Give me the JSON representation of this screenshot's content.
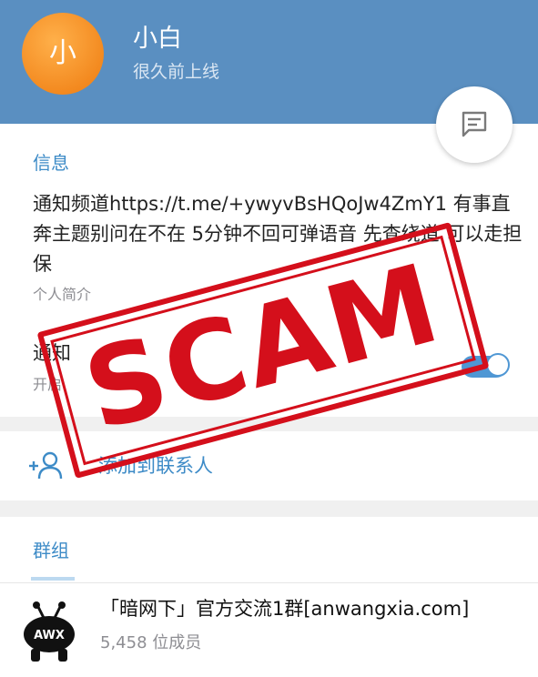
{
  "header": {
    "avatar_initial": "小",
    "name": "小白",
    "last_seen": "很久前上线",
    "avatar_color": "#f38a20",
    "bg_color": "#5a8fc1"
  },
  "fab": {
    "icon": "message-icon"
  },
  "info": {
    "section_title": "信息",
    "bio": "通知频道https://t.me/+ywyvBsHQoJw4ZmY1 有事直奔主题别问在不在 5分钟不回可弹语音 先查绕道 可以走担保",
    "bio_caption": "个人简介",
    "notifications_label": "通知",
    "notifications_sub": "开启",
    "notifications_on": true
  },
  "add_contact": {
    "label": "添加到联系人",
    "icon": "add-user-icon"
  },
  "groups": {
    "section_title": "群组",
    "items": [
      {
        "title": "「暗网下」官方交流1群[anwangxia.com]",
        "members": "5,458 位成员",
        "icon_text": "AWX"
      }
    ]
  },
  "stamp": {
    "text": "SCAM",
    "color": "#d40f1b"
  }
}
